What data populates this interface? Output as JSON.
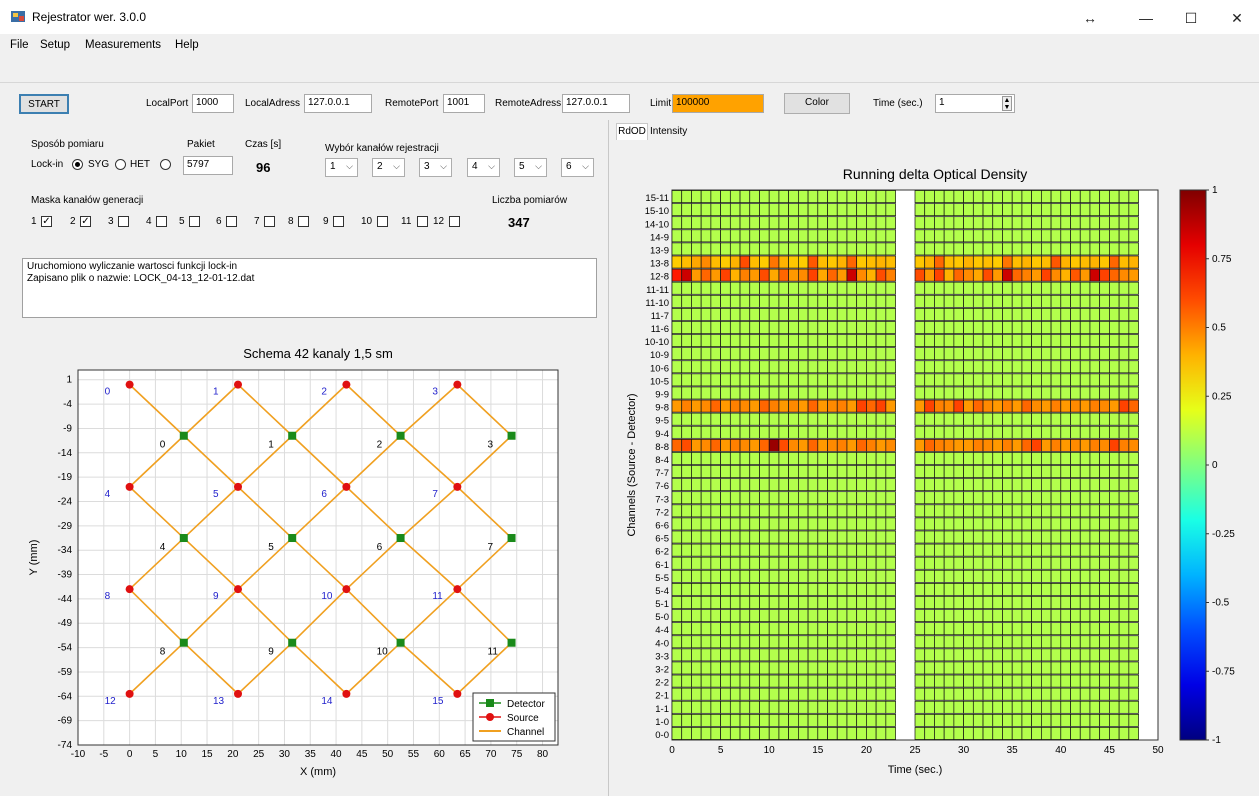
{
  "window": {
    "title": "Rejestrator wer. 3.0.0",
    "resize_glyph": "↔",
    "minimize": "—",
    "maximize": "☐",
    "close": "✕"
  },
  "menu": [
    "File",
    "Setup",
    "Measurements",
    "Help"
  ],
  "toolbar": {
    "start_label": "START",
    "local_port_label": "LocalPort",
    "local_port": "1000",
    "local_address_label": "LocalAdress",
    "local_address": "127.0.0.1",
    "remote_port_label": "RemotePort",
    "remote_port": "1001",
    "remote_address_label": "RemoteAdress",
    "remote_address": "127.0.0.1",
    "limit_label": "Limit",
    "limit": "100000",
    "color_label": "Color",
    "time_label": "Time (sec.)",
    "time": "1",
    "limit_color": "#ffa200"
  },
  "settings": {
    "mode_label": "Sposób pomiaru",
    "lockin_label": "Lock-in",
    "syg_label": "SYG",
    "het_label": "HET",
    "packet_label": "Pakiet",
    "packet_value": "5797",
    "time_label": "Czas [s]",
    "time_value": "96",
    "channel_select_label": "Wybór kanałów rejestracji",
    "channel_combos": [
      "1",
      "2",
      "3",
      "4",
      "5",
      "6"
    ],
    "mask_label": "Maska kanałów generacji",
    "mask_checkboxes": [
      {
        "label": "1",
        "checked": true
      },
      {
        "label": "2",
        "checked": true
      },
      {
        "label": "3",
        "checked": false
      },
      {
        "label": "4",
        "checked": false
      },
      {
        "label": "5",
        "checked": false
      },
      {
        "label": "6",
        "checked": false
      },
      {
        "label": "7",
        "checked": false
      },
      {
        "label": "8",
        "checked": false
      },
      {
        "label": "9",
        "checked": false
      },
      {
        "label": "10",
        "checked": false
      },
      {
        "label": "11",
        "checked": false
      },
      {
        "label": "12",
        "checked": false
      }
    ],
    "count_label": "Liczba pomiarów",
    "count_value": "347"
  },
  "log": {
    "lines": [
      "Uruchomiono wyliczanie wartosci funkcji lock-in",
      "Zapisano plik o nazwie: LOCK_04-13_12-01-12.dat"
    ]
  },
  "tabs": [
    "RdOD",
    "Intensity"
  ],
  "chart_data": [
    {
      "type": "scatter",
      "title": "Schema 42 kanaly 1,5 sm",
      "xlabel": "X (mm)",
      "ylabel": "Y (mm)",
      "xlim": [
        -10,
        83
      ],
      "ylim": [
        -74,
        3
      ],
      "xticks": [
        -10,
        -5,
        0,
        5,
        10,
        15,
        20,
        25,
        30,
        35,
        40,
        45,
        50,
        55,
        60,
        65,
        70,
        75,
        80
      ],
      "yticks": [
        1,
        -4,
        -9,
        -14,
        -19,
        -24,
        -29,
        -34,
        -39,
        -44,
        -49,
        -54,
        -59,
        -64,
        -69,
        -74
      ],
      "grid": true,
      "legend_position": "bottom-right",
      "colors": {
        "detector": "#1a8a1a",
        "source": "#e01010",
        "channel": "#f0a020",
        "source_label": "#2222cc",
        "detector_label": "#000000"
      },
      "series": [
        {
          "name": "Detector",
          "points": [
            {
              "id": "0",
              "x": 10.5,
              "y": -10.5
            },
            {
              "id": "1",
              "x": 31.5,
              "y": -10.5
            },
            {
              "id": "2",
              "x": 52.5,
              "y": -10.5
            },
            {
              "id": "3",
              "x": 74,
              "y": -10.5
            },
            {
              "id": "4",
              "x": 10.5,
              "y": -31.5
            },
            {
              "id": "5",
              "x": 31.5,
              "y": -31.5
            },
            {
              "id": "6",
              "x": 52.5,
              "y": -31.5
            },
            {
              "id": "7",
              "x": 74,
              "y": -31.5
            },
            {
              "id": "8",
              "x": 10.5,
              "y": -53
            },
            {
              "id": "9",
              "x": 31.5,
              "y": -53
            },
            {
              "id": "10",
              "x": 52.5,
              "y": -53
            },
            {
              "id": "11",
              "x": 74,
              "y": -53
            }
          ]
        },
        {
          "name": "Source",
          "points": [
            {
              "id": "0",
              "x": 0,
              "y": 0
            },
            {
              "id": "1",
              "x": 21,
              "y": 0
            },
            {
              "id": "2",
              "x": 42,
              "y": 0
            },
            {
              "id": "3",
              "x": 63.5,
              "y": 0
            },
            {
              "id": "4",
              "x": 0,
              "y": -21
            },
            {
              "id": "5",
              "x": 21,
              "y": -21
            },
            {
              "id": "6",
              "x": 42,
              "y": -21
            },
            {
              "id": "7",
              "x": 63.5,
              "y": -21
            },
            {
              "id": "8",
              "x": 0,
              "y": -42
            },
            {
              "id": "9",
              "x": 21,
              "y": -42
            },
            {
              "id": "10",
              "x": 42,
              "y": -42
            },
            {
              "id": "11",
              "x": 63.5,
              "y": -42
            },
            {
              "id": "12",
              "x": 0,
              "y": -63.5
            },
            {
              "id": "13",
              "x": 21,
              "y": -63.5
            },
            {
              "id": "14",
              "x": 42,
              "y": -63.5
            },
            {
              "id": "15",
              "x": 63.5,
              "y": -63.5
            }
          ]
        },
        {
          "name": "Channel"
        }
      ],
      "channels": [
        [
          0,
          0
        ],
        [
          1,
          0
        ],
        [
          4,
          0
        ],
        [
          5,
          0
        ],
        [
          1,
          1
        ],
        [
          2,
          1
        ],
        [
          5,
          1
        ],
        [
          6,
          1
        ],
        [
          2,
          2
        ],
        [
          3,
          2
        ],
        [
          6,
          2
        ],
        [
          7,
          2
        ],
        [
          3,
          3
        ],
        [
          7,
          3
        ],
        [
          4,
          4
        ],
        [
          5,
          4
        ],
        [
          8,
          4
        ],
        [
          9,
          4
        ],
        [
          5,
          5
        ],
        [
          6,
          5
        ],
        [
          9,
          5
        ],
        [
          10,
          5
        ],
        [
          6,
          6
        ],
        [
          7,
          6
        ],
        [
          10,
          6
        ],
        [
          11,
          6
        ],
        [
          7,
          7
        ],
        [
          11,
          7
        ],
        [
          8,
          8
        ],
        [
          9,
          8
        ],
        [
          12,
          8
        ],
        [
          13,
          8
        ],
        [
          9,
          9
        ],
        [
          10,
          9
        ],
        [
          13,
          9
        ],
        [
          14,
          9
        ],
        [
          10,
          10
        ],
        [
          11,
          10
        ],
        [
          14,
          10
        ],
        [
          15,
          10
        ],
        [
          11,
          11
        ],
        [
          15,
          11
        ]
      ]
    },
    {
      "type": "heatmap",
      "title": "Running delta Optical Density",
      "xlabel": "Time (sec.)",
      "ylabel": "Channels (Source - Detector)",
      "xlim": [
        0,
        50
      ],
      "xticks": [
        0,
        5,
        10,
        15,
        20,
        25,
        30,
        35,
        40,
        45,
        50
      ],
      "colorbar_ticks": [
        1,
        0.75,
        0.5,
        0.25,
        0,
        -0.25,
        -0.5,
        -0.75,
        -1
      ],
      "clim": [
        -1,
        1
      ],
      "rows": [
        "15-11",
        "15-10",
        "14-10",
        "14-9",
        "13-9",
        "13-8",
        "12-8",
        "11-11",
        "11-10",
        "11-7",
        "11-6",
        "10-10",
        "10-9",
        "10-6",
        "10-5",
        "9-9",
        "9-8",
        "9-5",
        "9-4",
        "8-8",
        "8-4",
        "7-7",
        "7-6",
        "7-3",
        "7-2",
        "6-6",
        "6-5",
        "6-2",
        "6-1",
        "5-5",
        "5-4",
        "5-1",
        "5-0",
        "4-4",
        "4-0",
        "3-3",
        "3-2",
        "2-2",
        "2-1",
        "1-1",
        "1-0",
        "0-0"
      ],
      "time_blocks": [
        [
          0,
          23
        ],
        [
          25,
          48
        ]
      ],
      "background_value": 0.1,
      "highlight_rows": {
        "13-8": [
          0.35,
          0.38,
          0.42,
          0.48,
          0.38,
          0.35,
          0.4,
          0.6,
          0.38,
          0.35,
          0.52,
          0.4,
          0.36,
          0.35,
          0.58,
          0.38,
          0.36,
          0.4,
          0.55,
          0.36,
          0.38,
          0.4,
          0.38,
          0.36,
          0.4,
          0.55,
          0.38,
          0.36,
          0.4,
          0.36,
          0.38,
          0.35,
          0.52,
          0.38,
          0.4,
          0.36,
          0.38,
          0.58,
          0.4,
          0.36,
          0.38,
          0.4,
          0.36,
          0.55,
          0.38,
          0.4,
          0.36,
          0.38
        ],
        "12-8": [
          0.7,
          0.85,
          0.45,
          0.55,
          0.45,
          0.62,
          0.4,
          0.5,
          0.45,
          0.6,
          0.42,
          0.55,
          0.45,
          0.48,
          0.62,
          0.42,
          0.55,
          0.45,
          0.85,
          0.48,
          0.4,
          0.6,
          0.5,
          0.6,
          0.45,
          0.62,
          0.4,
          0.55,
          0.48,
          0.42,
          0.6,
          0.45,
          0.85,
          0.55,
          0.5,
          0.45,
          0.62,
          0.48,
          0.4,
          0.58,
          0.45,
          0.85,
          0.62,
          0.55,
          0.48,
          0.45,
          0.5,
          0.45
        ],
        "9-8": [
          0.45,
          0.5,
          0.45,
          0.48,
          0.55,
          0.45,
          0.5,
          0.48,
          0.45,
          0.55,
          0.5,
          0.45,
          0.48,
          0.45,
          0.55,
          0.45,
          0.48,
          0.5,
          0.45,
          0.62,
          0.55,
          0.62,
          0.45,
          0.45,
          0.62,
          0.5,
          0.48,
          0.62,
          0.45,
          0.55,
          0.48,
          0.45,
          0.5,
          0.45,
          0.55,
          0.48,
          0.45,
          0.5,
          0.45,
          0.48,
          0.45,
          0.5,
          0.48,
          0.45,
          0.62,
          0.55,
          0.45,
          0.48
        ],
        "8-8": [
          0.55,
          0.6,
          0.45,
          0.48,
          0.55,
          0.45,
          0.5,
          0.48,
          0.45,
          0.55,
          0.95,
          0.6,
          0.48,
          0.45,
          0.55,
          0.45,
          0.48,
          0.5,
          0.45,
          0.55,
          0.5,
          0.45,
          0.48,
          0.45,
          0.55,
          0.5,
          0.48,
          0.45,
          0.45,
          0.5,
          0.48,
          0.45,
          0.5,
          0.45,
          0.55,
          0.62,
          0.45,
          0.5,
          0.45,
          0.48,
          0.45,
          0.5,
          0.48,
          0.62,
          0.5,
          0.48,
          0.45,
          0.45
        ]
      }
    }
  ]
}
